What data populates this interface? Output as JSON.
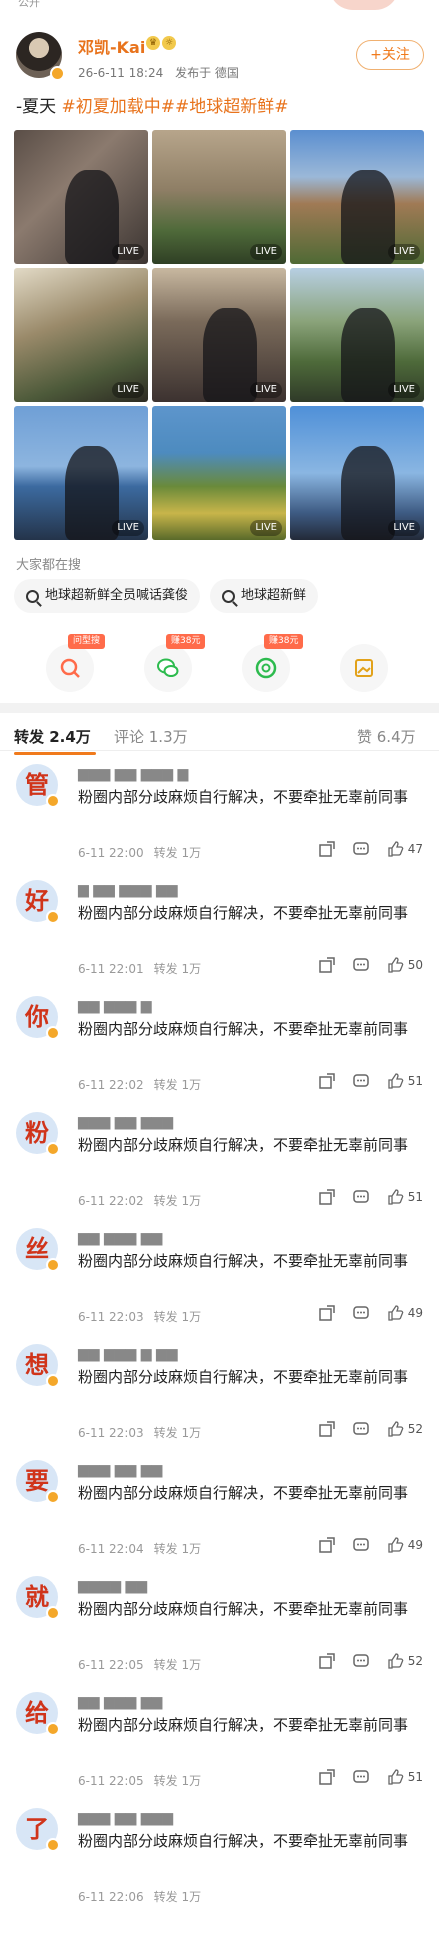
{
  "top": {
    "visibility": "公开"
  },
  "post": {
    "author": "邓凯-Kai",
    "time": "26-6-11 18:24",
    "source": "发布于 德国",
    "follow_label": "+关注",
    "text_plain": "-夏天 ",
    "tags": "#初夏加载中##地球超新鲜#",
    "live_label": "LIVE"
  },
  "search": {
    "title": "大家都在搜",
    "chips": [
      "地球超新鲜全员喊话龚俊",
      "地球超新鲜"
    ]
  },
  "actions": [
    {
      "name": "ask-search",
      "tag": "问型搜"
    },
    {
      "name": "wechat",
      "tag": "赚38元"
    },
    {
      "name": "moments",
      "tag": "赚38元"
    },
    {
      "name": "save-image",
      "tag": ""
    }
  ],
  "tabs": {
    "repost": "转发 2.4万",
    "comment": "评论 1.3万",
    "like": "赞 6.4万"
  },
  "comments": [
    {
      "avatar": "管",
      "text": "粉圈内部分歧麻烦自行解决，不要牵扯无辜前同事",
      "time": "6-11 22:00",
      "repost": "转发 1万",
      "likes": "47"
    },
    {
      "avatar": "好",
      "text": "粉圈内部分歧麻烦自行解决，不要牵扯无辜前同事",
      "time": "6-11 22:01",
      "repost": "转发 1万",
      "likes": "50"
    },
    {
      "avatar": "你",
      "text": "粉圈内部分歧麻烦自行解决，不要牵扯无辜前同事",
      "time": "6-11 22:02",
      "repost": "转发 1万",
      "likes": "51"
    },
    {
      "avatar": "粉",
      "text": "粉圈内部分歧麻烦自行解决，不要牵扯无辜前同事",
      "time": "6-11 22:02",
      "repost": "转发 1万",
      "likes": "51"
    },
    {
      "avatar": "丝",
      "text": "粉圈内部分歧麻烦自行解决，不要牵扯无辜前同事",
      "time": "6-11 22:03",
      "repost": "转发 1万",
      "likes": "49"
    },
    {
      "avatar": "想",
      "text": "粉圈内部分歧麻烦自行解决，不要牵扯无辜前同事",
      "time": "6-11 22:03",
      "repost": "转发 1万",
      "likes": "52"
    },
    {
      "avatar": "要",
      "text": "粉圈内部分歧麻烦自行解决，不要牵扯无辜前同事",
      "time": "6-11 22:04",
      "repost": "转发 1万",
      "likes": "49"
    },
    {
      "avatar": "就",
      "text": "粉圈内部分歧麻烦自行解决，不要牵扯无辜前同事",
      "time": "6-11 22:05",
      "repost": "转发 1万",
      "likes": "52"
    },
    {
      "avatar": "给",
      "text": "粉圈内部分歧麻烦自行解决，不要牵扯无辜前同事",
      "time": "6-11 22:05",
      "repost": "转发 1万",
      "likes": "51"
    },
    {
      "avatar": "了",
      "text": "粉圈内部分歧麻烦自行解决，不要牵扯无辜前同事",
      "time": "6-11 22:06",
      "repost": "转发 1万",
      "likes": ""
    }
  ],
  "colors": {
    "accent": "#f07a1c",
    "avatar_text": "#d0341a",
    "avatar_bg": "#d8e6f6"
  }
}
